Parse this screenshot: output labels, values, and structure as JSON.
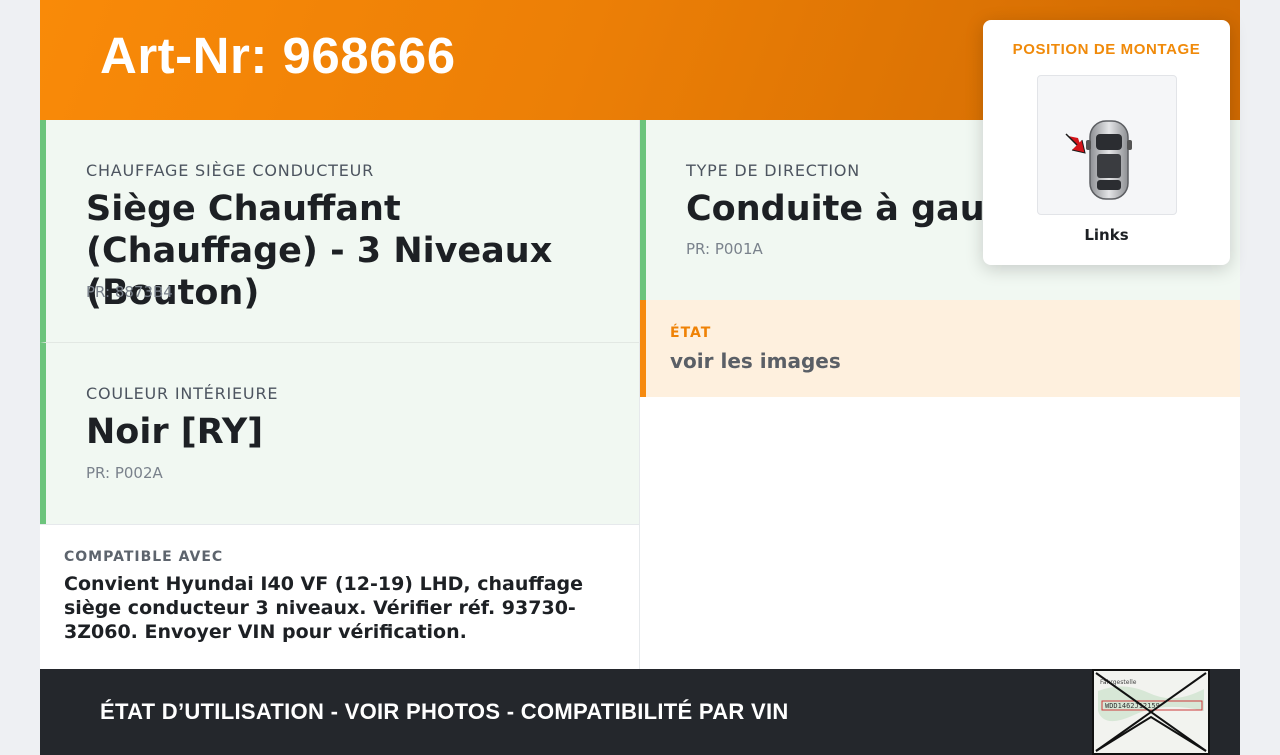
{
  "header": {
    "title": "Art-Nr: 968666"
  },
  "details": {
    "seat_heating": {
      "label": "CHAUFFAGE SIÈGE CONDUCTEUR",
      "value": "Siège Chauffant (Chauffage) - 3 Niveaux (Bouton)",
      "pr": "PR: 8873B4"
    },
    "interior_color": {
      "label": "COULEUR INTÉRIEURE",
      "value": "Noir [RY]",
      "pr": "PR: P002A"
    },
    "steering": {
      "label": "TYPE DE DIRECTION",
      "value": "Conduite à gauche",
      "pr": "PR: P001A"
    }
  },
  "state": {
    "label": "ÉTAT",
    "value": "voir les images"
  },
  "compatibility": {
    "label": "COMPATIBLE AVEC",
    "text": "Convient Hyundai I40 VF (12-19) LHD, chauffage siège conducteur 3 niveaux. Vérifier réf. 93730-3Z060. Envoyer VIN pour vérification."
  },
  "mounting": {
    "label": "POSITION DE MONTAGE",
    "caption": "Links",
    "image_icon": "car-top-view-icon"
  },
  "footer": {
    "text": "ÉTAT D’UTILISATION - VOIR PHOTOS - COMPATIBILITÉ PAR VIN",
    "thumbnail_lines": [
      "Fahrgestelle",
      "WDD1462J12159"
    ]
  },
  "colors": {
    "brand_orange": "#f08a0a",
    "green_accent": "#6cc47c",
    "footer_bg": "#24272c"
  }
}
